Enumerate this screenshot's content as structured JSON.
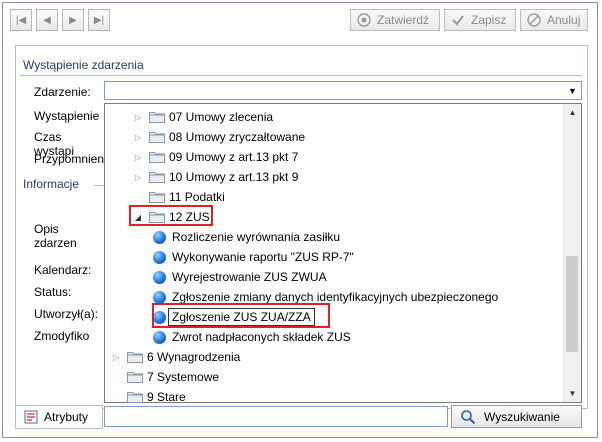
{
  "toolbar": {
    "confirm_label": "Zatwierdź",
    "save_label": "Zapisz",
    "cancel_label": "Anuluj"
  },
  "groups": {
    "event_title": "Wystąpienie zdarzenia",
    "info_title": "Informacje"
  },
  "fields": {
    "event_label": "Zdarzenie:",
    "occurrence_label": "Wystąpienie",
    "time_label": "Czas wystąpi",
    "reminder_label": "Przypomnien",
    "description_label": "Opis zdarzen",
    "calendar_label": "Kalendarz:",
    "status_label": "Status:",
    "created_label": "Utworzył(a):",
    "modified_label": "Zmodyfiko"
  },
  "event_combo": {
    "value": ""
  },
  "tree": {
    "items": [
      {
        "label": "07 Umowy zlecenia",
        "type": "folder",
        "expand": "collapsed"
      },
      {
        "label": "08 Umowy zryczałtowane",
        "type": "folder",
        "expand": "collapsed"
      },
      {
        "label": "09 Umowy z art.13 pkt 7",
        "type": "folder",
        "expand": "collapsed"
      },
      {
        "label": "10 Umowy z art.13 pkt 9",
        "type": "folder",
        "expand": "collapsed"
      },
      {
        "label": "11 Podatki",
        "type": "folder",
        "expand": "none"
      },
      {
        "label": "12 ZUS",
        "type": "folder",
        "expand": "expanded"
      },
      {
        "label": "Rozliczenie wyrównania zasiłku",
        "type": "item"
      },
      {
        "label": "Wykonywanie raportu \"ZUS RP-7\"",
        "type": "item"
      },
      {
        "label": "Wyrejestrowanie ZUS ZWUA",
        "type": "item"
      },
      {
        "label": "Zgłoszenie zmiany danych identyfikacyjnych ubezpieczonego",
        "type": "item"
      },
      {
        "label": "Zgłoszenie ZUS ZUA/ZZA",
        "type": "item",
        "selected": true
      },
      {
        "label": "Zwrot nadpłaconych składek ZUS",
        "type": "item"
      },
      {
        "label": "6 Wynagrodzenia",
        "type": "folder",
        "expand": "collapsed"
      },
      {
        "label": "7 Systemowe",
        "type": "folder",
        "expand": "none"
      },
      {
        "label": "9 Stare",
        "type": "folder",
        "expand": "none"
      }
    ]
  },
  "bottom": {
    "tab_label": "Atrybuty",
    "search_value": "",
    "search_button_label": "Wyszukiwanie"
  },
  "colors": {
    "highlight": "#d9222a",
    "group_title": "#1e3a78"
  }
}
